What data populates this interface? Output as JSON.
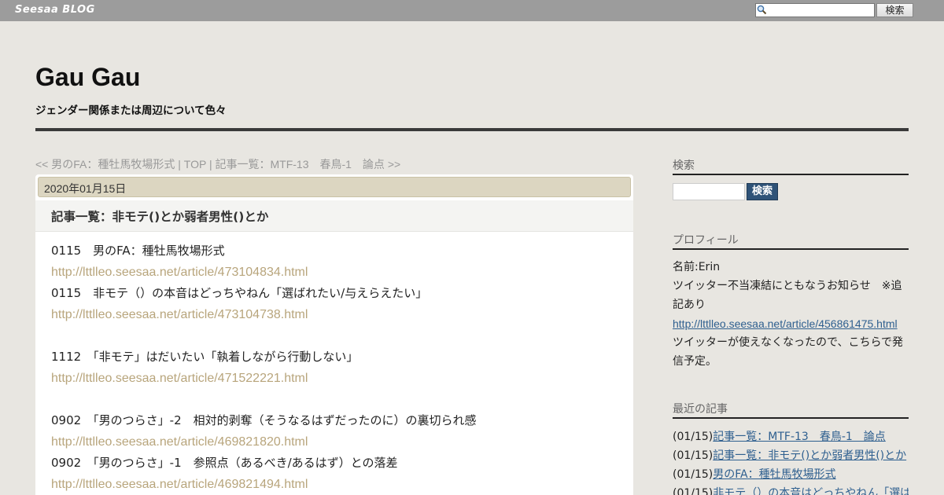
{
  "topbar": {
    "logo": "Seesaa BLOG",
    "search_button": "検索",
    "search_value": ""
  },
  "header": {
    "title": "Gau Gau",
    "description": "ジェンダー関係または周辺について色々"
  },
  "pager": {
    "prev": "<< 男のFA：種牡馬牧場形式",
    "sep1": " | ",
    "top": "TOP",
    "sep2": " | ",
    "next": "記事一覧：MTF-13　春鳥-1　論点 >>"
  },
  "article": {
    "date": "2020年01月15日",
    "title": "記事一覧：非モテ()とか弱者男性()とか",
    "lines": [
      {
        "type": "text",
        "text": "0115　男のFA：種牡馬牧場形式"
      },
      {
        "type": "url",
        "text": "http://lttlleo.seesaa.net/article/473104834.html"
      },
      {
        "type": "text",
        "text": "0115　非モテ（）の本音はどっちやねん「選ばれたい/与えらえたい」"
      },
      {
        "type": "url",
        "text": "http://lttlleo.seesaa.net/article/473104738.html"
      },
      {
        "type": "blank",
        "text": ""
      },
      {
        "type": "text",
        "text": "1112　「非モテ」はだいたい「執着しながら行動しない」"
      },
      {
        "type": "url",
        "text": "http://lttlleo.seesaa.net/article/471522221.html"
      },
      {
        "type": "blank",
        "text": ""
      },
      {
        "type": "text",
        "text": "0902　「男のつらさ」-2　相対的剥奪（そうなるはずだったのに）の裏切られ感"
      },
      {
        "type": "url",
        "text": "http://lttlleo.seesaa.net/article/469821820.html"
      },
      {
        "type": "text",
        "text": "0902　「男のつらさ」-1　参照点（あるべき/あるはず）との落差"
      },
      {
        "type": "url",
        "text": "http://lttlleo.seesaa.net/article/469821494.html"
      }
    ]
  },
  "sidebar": {
    "search": {
      "heading": "検索",
      "button": "検索",
      "value": ""
    },
    "profile": {
      "heading": "プロフィール",
      "name": "名前:Erin",
      "notice": "ツイッター不当凍結にともなうお知らせ　※追記あり",
      "link": "http://lttlleo.seesaa.net/article/456861475.html",
      "note": "ツイッターが使えなくなったので、こちらで発信予定。"
    },
    "recent": {
      "heading": "最近の記事",
      "items": [
        {
          "date": "(01/15)",
          "title": "記事一覧：MTF-13　春鳥-1　論点"
        },
        {
          "date": "(01/15)",
          "title": "記事一覧：非モテ()とか弱者男性()とか"
        },
        {
          "date": "(01/15)",
          "title": "男のFA：種牡馬牧場形式"
        },
        {
          "date": "(01/15)",
          "title": "非モテ（）の本音はどっちやねん「選ばれたい/与えらえたい」"
        }
      ]
    }
  },
  "colors": {
    "background": "#e8e6e1",
    "topbar": "#9c9c9c",
    "date_bar": "#dcd6c1",
    "article_url": "#b8a57c",
    "sidebar_link": "#2e5f8f",
    "search_button": "#2f5378"
  }
}
